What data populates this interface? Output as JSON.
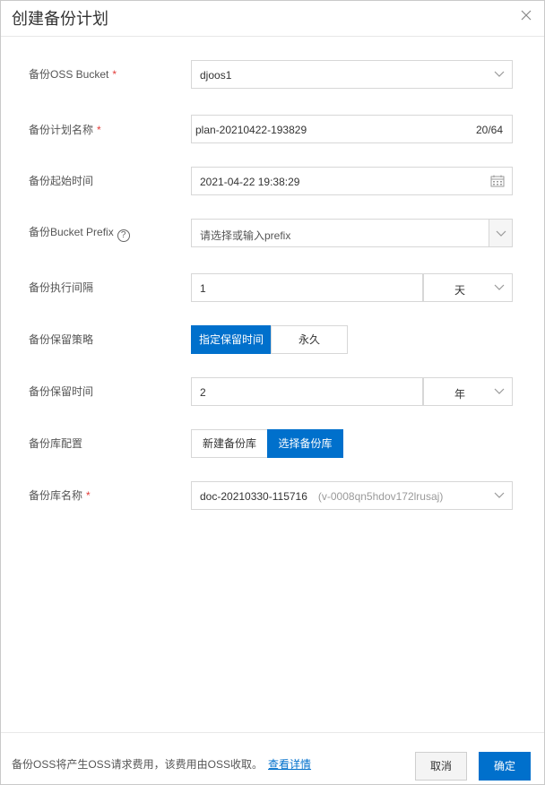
{
  "dialog": {
    "title": "创建备份计划",
    "close_icon": "close-icon"
  },
  "form": {
    "bucket": {
      "label": "备份OSS Bucket",
      "value": "djoos1"
    },
    "plan_name": {
      "label": "备份计划名称",
      "value": "plan-20210422-193829",
      "counter": "20/64"
    },
    "start_time": {
      "label": "备份起始时间",
      "value": "2021-04-22 19:38:29",
      "icon": "calendar-icon"
    },
    "prefix": {
      "label": "备份Bucket Prefix",
      "help": "?",
      "placeholder": "请选择或输入prefix"
    },
    "interval": {
      "label": "备份执行间隔",
      "value": "1",
      "unit": "天"
    },
    "retention_policy": {
      "label": "备份保留策略",
      "options": [
        "指定保留时间",
        "永久"
      ],
      "selected": "指定保留时间"
    },
    "retention_time": {
      "label": "备份保留时间",
      "value": "2",
      "unit": "年"
    },
    "vault_config": {
      "label": "备份库配置",
      "options": [
        "新建备份库",
        "选择备份库"
      ],
      "selected": "选择备份库"
    },
    "vault_name": {
      "label": "备份库名称",
      "value": "doc-20210330-115716",
      "sub": "(v-0008qn5hdov172lrusaj)"
    },
    "required_mark": "*"
  },
  "footer": {
    "note": "备份OSS将产生OSS请求费用，该费用由OSS收取。",
    "link": "查看详情",
    "cancel": "取消",
    "confirm": "确定"
  },
  "colors": {
    "accent": "#0070cc",
    "required": "#e23c39"
  }
}
